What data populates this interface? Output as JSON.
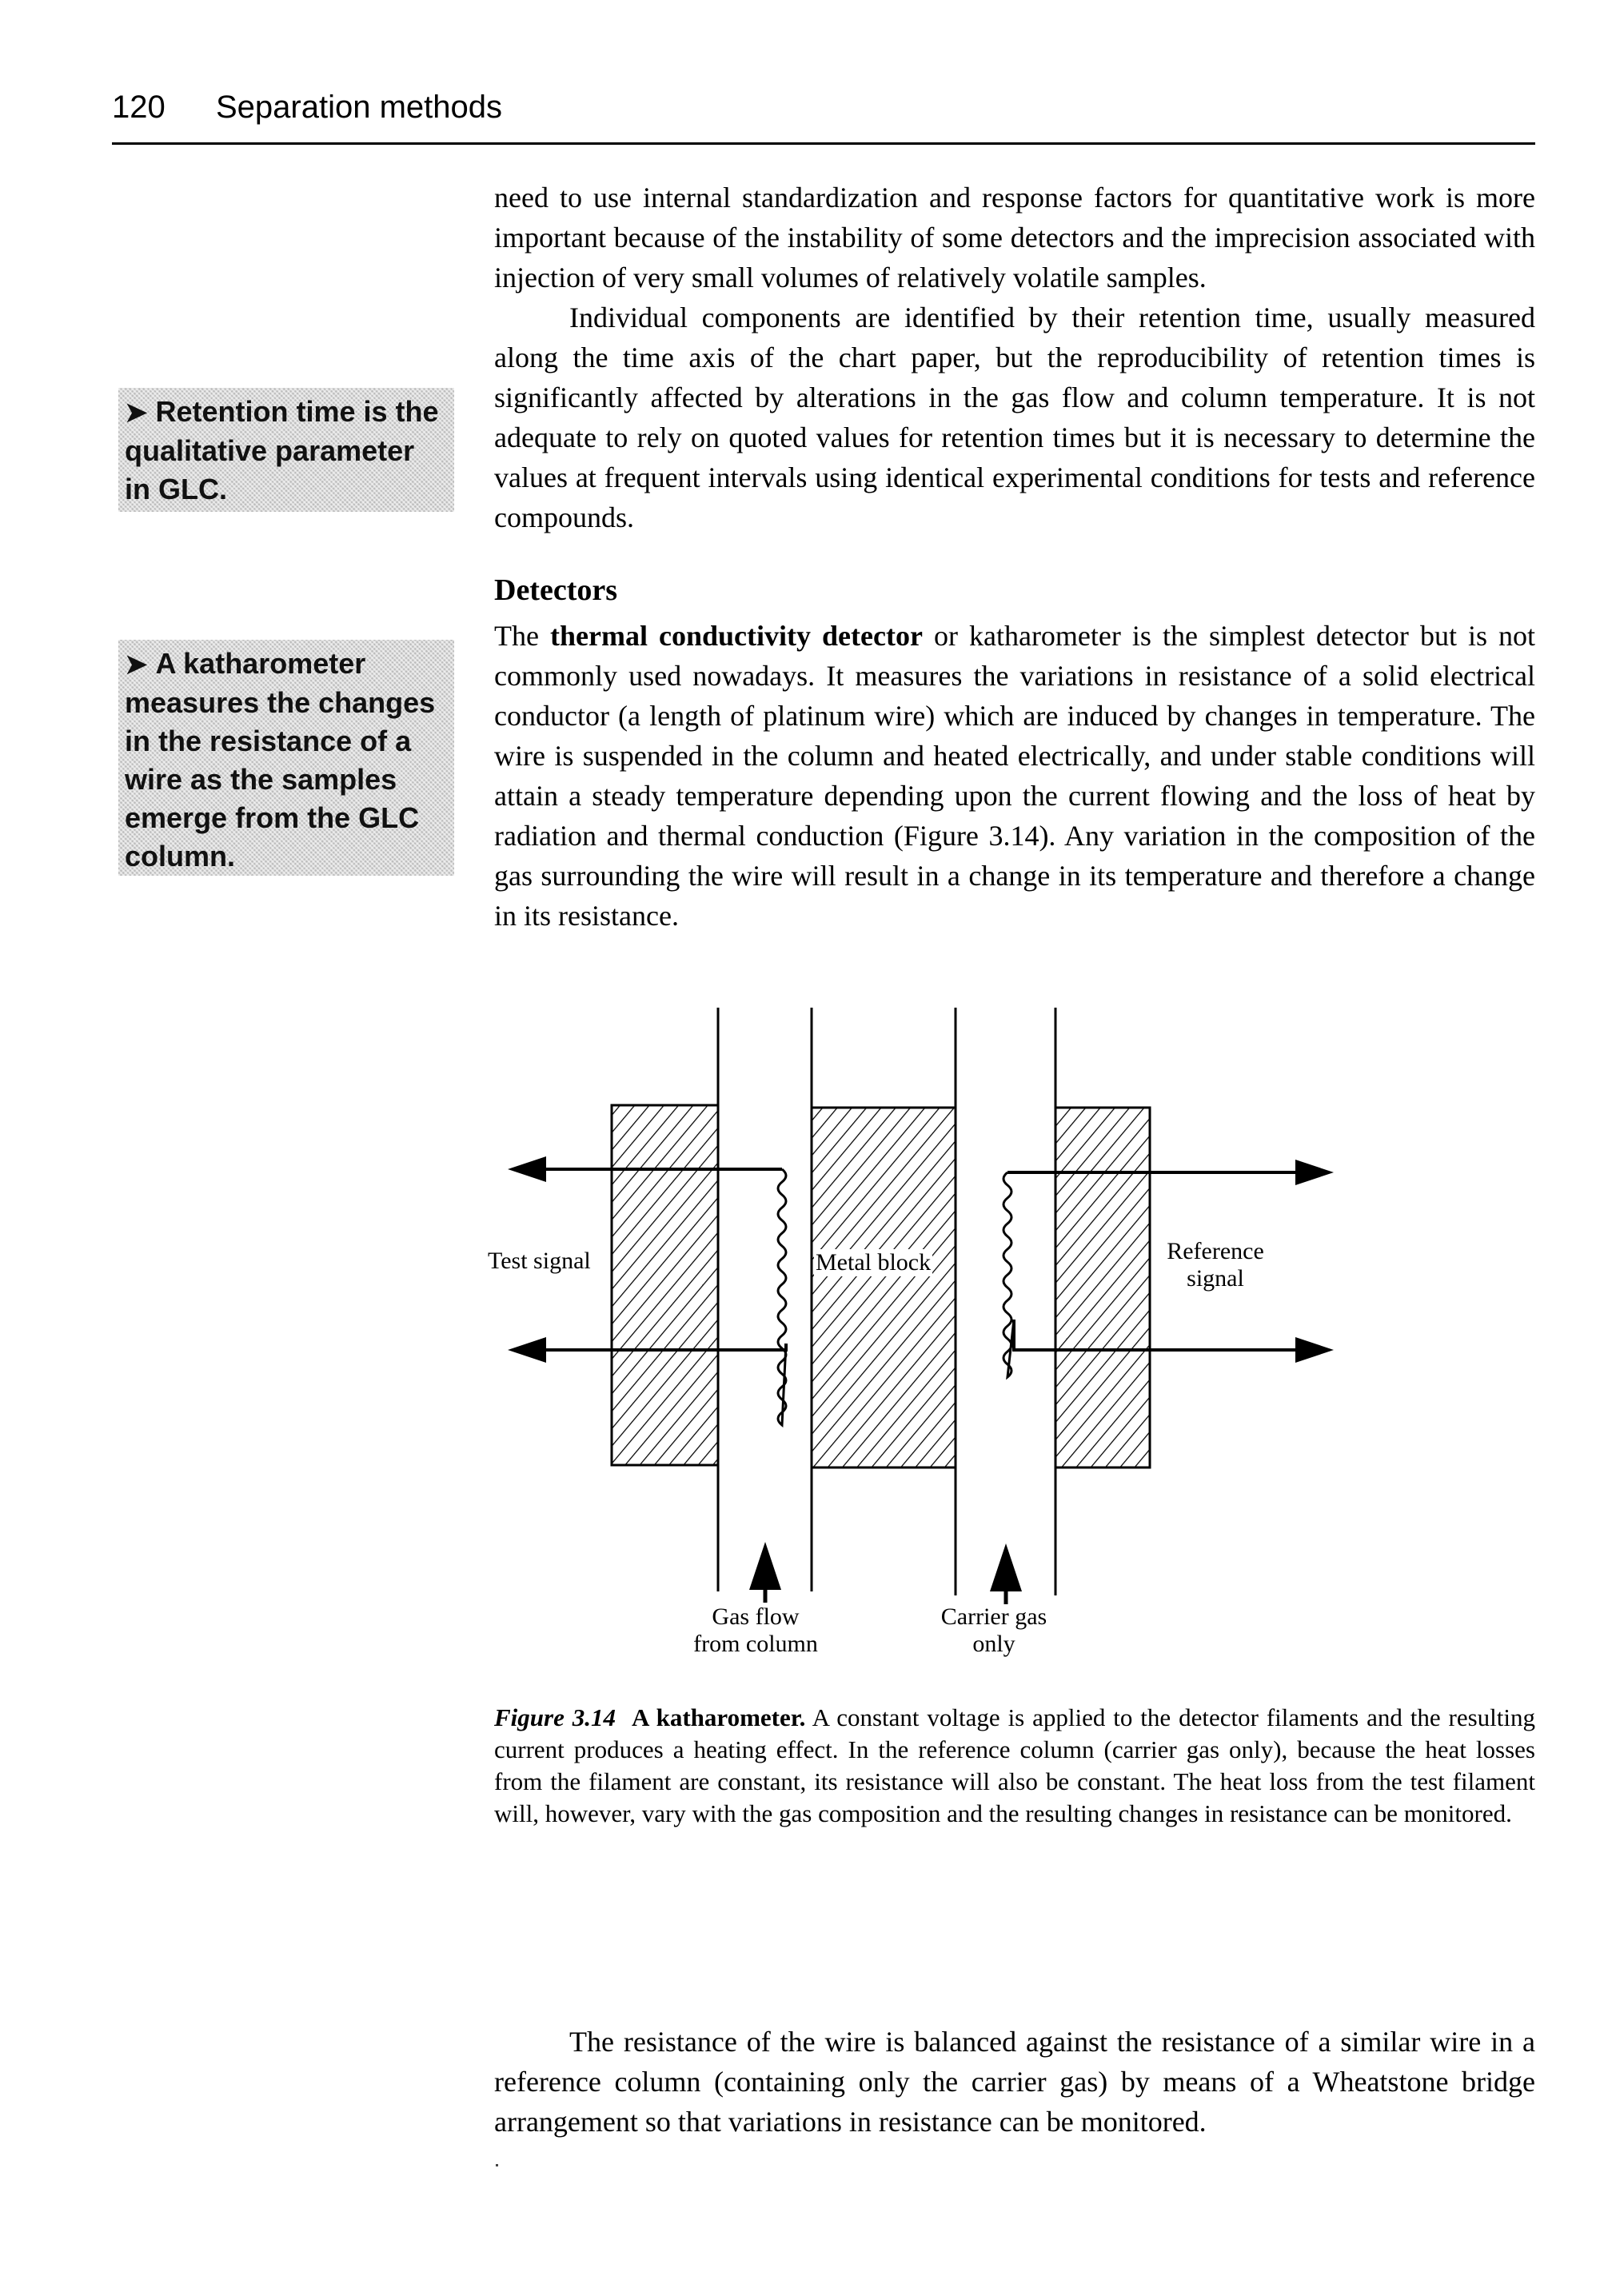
{
  "header": {
    "page_number": "120",
    "running_title": "Separation methods"
  },
  "body": {
    "paragraph_1": "need to use internal standardization and response factors for quantitative work is more important because of the instability of some detectors and the imprecision associated with injection of very small volumes of relatively volatile samples.",
    "paragraph_2": "Individual components are identified by their retention time, usually measured along the time axis of the chart paper, but the reproducibility of retention times is significantly affected by alterations in the gas flow and column temperature. It is not adequate to rely on quoted values for retention times but it is necessary to determine the values at frequent intervals using identical experimental conditions for tests and reference compounds.",
    "section_heading": "Detectors",
    "paragraph_3_lead": "The ",
    "paragraph_3_term": "thermal conductivity detector",
    "paragraph_3_rest": " or katharometer is the simplest detector but is not commonly used nowadays. It measures the variations in resistance of a solid electrical conductor (a length of platinum wire) which are induced by changes in temperature. The wire is suspended in the column and heated electrically, and under stable conditions will attain a steady temperature depending upon the current flowing and the loss of heat by radiation and thermal conduction (Figure 3.14). Any variation in the composition of the gas surrounding the wire will result in a change in its temperature and therefore a change in its resistance.",
    "paragraph_4": "The resistance of the wire is balanced against the resistance of a similar wire in a reference column (containing only the carrier gas) by means of a Wheatstone bridge arrangement so that variations in resistance can be monitored."
  },
  "margin_notes": [
    {
      "arrow": "➤",
      "text": "Retention time is the qualitative parameter in GLC."
    },
    {
      "arrow": "➤",
      "text": "A katharometer measures the changes in the resistance of a wire as the samples emerge from the GLC column."
    }
  ],
  "figure": {
    "labels": {
      "test_signal": "Test signal",
      "metal_block": "Metal block",
      "reference_signal_line1": "Reference",
      "reference_signal_line2": "signal",
      "gas_flow_line1": "Gas flow",
      "gas_flow_line2": "from column",
      "carrier_gas_line1": "Carrier gas",
      "carrier_gas_line2": "only"
    },
    "caption_number": "Figure 3.14",
    "caption_title": "A katharometer.",
    "caption_text": " A constant voltage is applied to the detector filaments and the resulting current produces a heating effect. In the reference column (carrier gas only), because the heat losses from the filament are constant, its resistance will also be constant. The heat loss from the test filament will, however, vary with the gas composition and the resulting changes in resistance can be monitored."
  }
}
